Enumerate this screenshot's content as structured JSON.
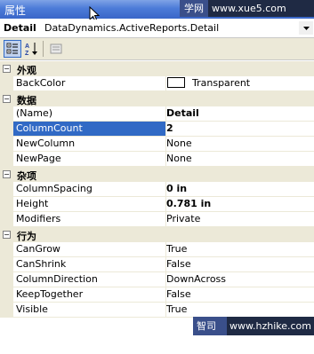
{
  "window": {
    "title": "属性"
  },
  "watermark_top": {
    "site": "学网",
    "url": "www.xue5.com"
  },
  "object_selector": {
    "name": "Detail",
    "type": "DataDynamics.ActiveReports.Detail"
  },
  "toolbar": {
    "buttons": [
      {
        "name": "categorized-icon",
        "active": true
      },
      {
        "name": "alphabetical-icon",
        "active": false
      },
      {
        "name": "property-pages-icon",
        "active": false
      }
    ]
  },
  "categories": [
    {
      "label": "外观",
      "expanded": true,
      "props": [
        {
          "name": "BackColor",
          "value": "Transparent",
          "swatch": "#ffffff"
        }
      ]
    },
    {
      "label": "数据",
      "expanded": true,
      "props": [
        {
          "name": "(Name)",
          "value": "Detail",
          "bold": true
        },
        {
          "name": "ColumnCount",
          "value": "2",
          "bold": true,
          "selected": true
        },
        {
          "name": "NewColumn",
          "value": "None"
        },
        {
          "name": "NewPage",
          "value": "None"
        }
      ]
    },
    {
      "label": "杂项",
      "expanded": true,
      "props": [
        {
          "name": "ColumnSpacing",
          "value": "0 in",
          "bold": true
        },
        {
          "name": "Height",
          "value": "0.781 in",
          "bold": true
        },
        {
          "name": "Modifiers",
          "value": "Private"
        }
      ]
    },
    {
      "label": "行为",
      "expanded": true,
      "props": [
        {
          "name": "CanGrow",
          "value": "True"
        },
        {
          "name": "CanShrink",
          "value": "False"
        },
        {
          "name": "ColumnDirection",
          "value": "DownAcross"
        },
        {
          "name": "KeepTogether",
          "value": "False"
        },
        {
          "name": "Visible",
          "value": "True"
        }
      ]
    }
  ],
  "watermark_bottom": {
    "site": "智司网",
    "url": "www.hzhike.com"
  },
  "colors": {
    "selection": "#316ac5",
    "category_bg": "#ece9d8",
    "titlebar": "#4c7bd8"
  }
}
